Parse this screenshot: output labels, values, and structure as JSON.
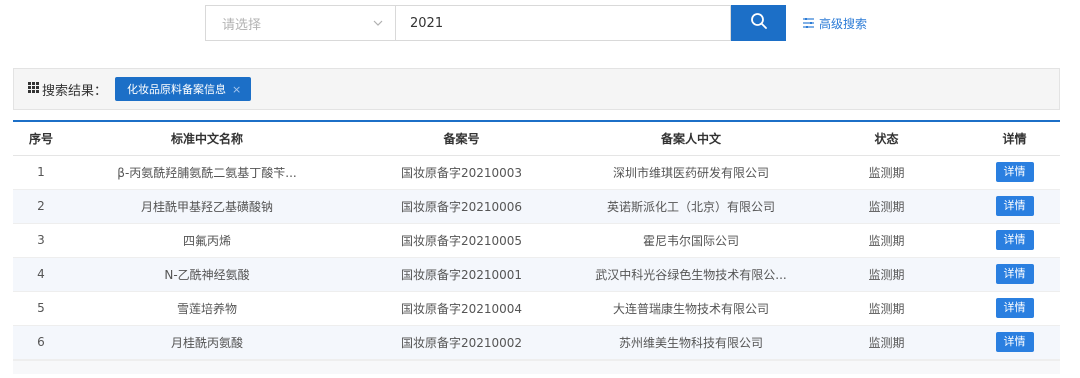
{
  "search": {
    "select_placeholder": "请选择",
    "query": "2021",
    "advanced_label": "高级搜索"
  },
  "results": {
    "label": "搜索结果：",
    "tag_label": "化妆品原料备案信息",
    "tag_close": "×"
  },
  "table": {
    "headers": [
      "序号",
      "标准中文名称",
      "备案号",
      "备案人中文",
      "状态",
      "详情"
    ],
    "detail_label": "详情",
    "rows": [
      {
        "index": "1",
        "name": "β-丙氨酰羟脯氨酰二氨基丁酸苄...",
        "record_no": "国妆原备字20210003",
        "applicant": "深圳市维琪医药研发有限公司",
        "status": "监测期"
      },
      {
        "index": "2",
        "name": "月桂酰甲基羟乙基磺酸钠",
        "record_no": "国妆原备字20210006",
        "applicant": "英诺斯派化工（北京）有限公司",
        "status": "监测期"
      },
      {
        "index": "3",
        "name": "四氟丙烯",
        "record_no": "国妆原备字20210005",
        "applicant": "霍尼韦尔国际公司",
        "status": "监测期"
      },
      {
        "index": "4",
        "name": "N-乙酰神经氨酸",
        "record_no": "国妆原备字20210001",
        "applicant": "武汉中科光谷绿色生物技术有限公...",
        "status": "监测期"
      },
      {
        "index": "5",
        "name": "雪莲培养物",
        "record_no": "国妆原备字20210004",
        "applicant": "大连普瑞康生物技术有限公司",
        "status": "监测期"
      },
      {
        "index": "6",
        "name": "月桂酰丙氨酸",
        "record_no": "国妆原备字20210002",
        "applicant": "苏州维美生物科技有限公司",
        "status": "监测期"
      }
    ]
  },
  "colors": {
    "accent": "#1c6fc7",
    "detail_button": "#2a7fe0",
    "row_alt": "#f4f7fc"
  },
  "icons": {
    "select_chevron": "chevron-down-icon",
    "search": "search-icon",
    "advanced": "filter-lines-icon",
    "results": "grid-icon",
    "tag_close": "close-icon"
  }
}
